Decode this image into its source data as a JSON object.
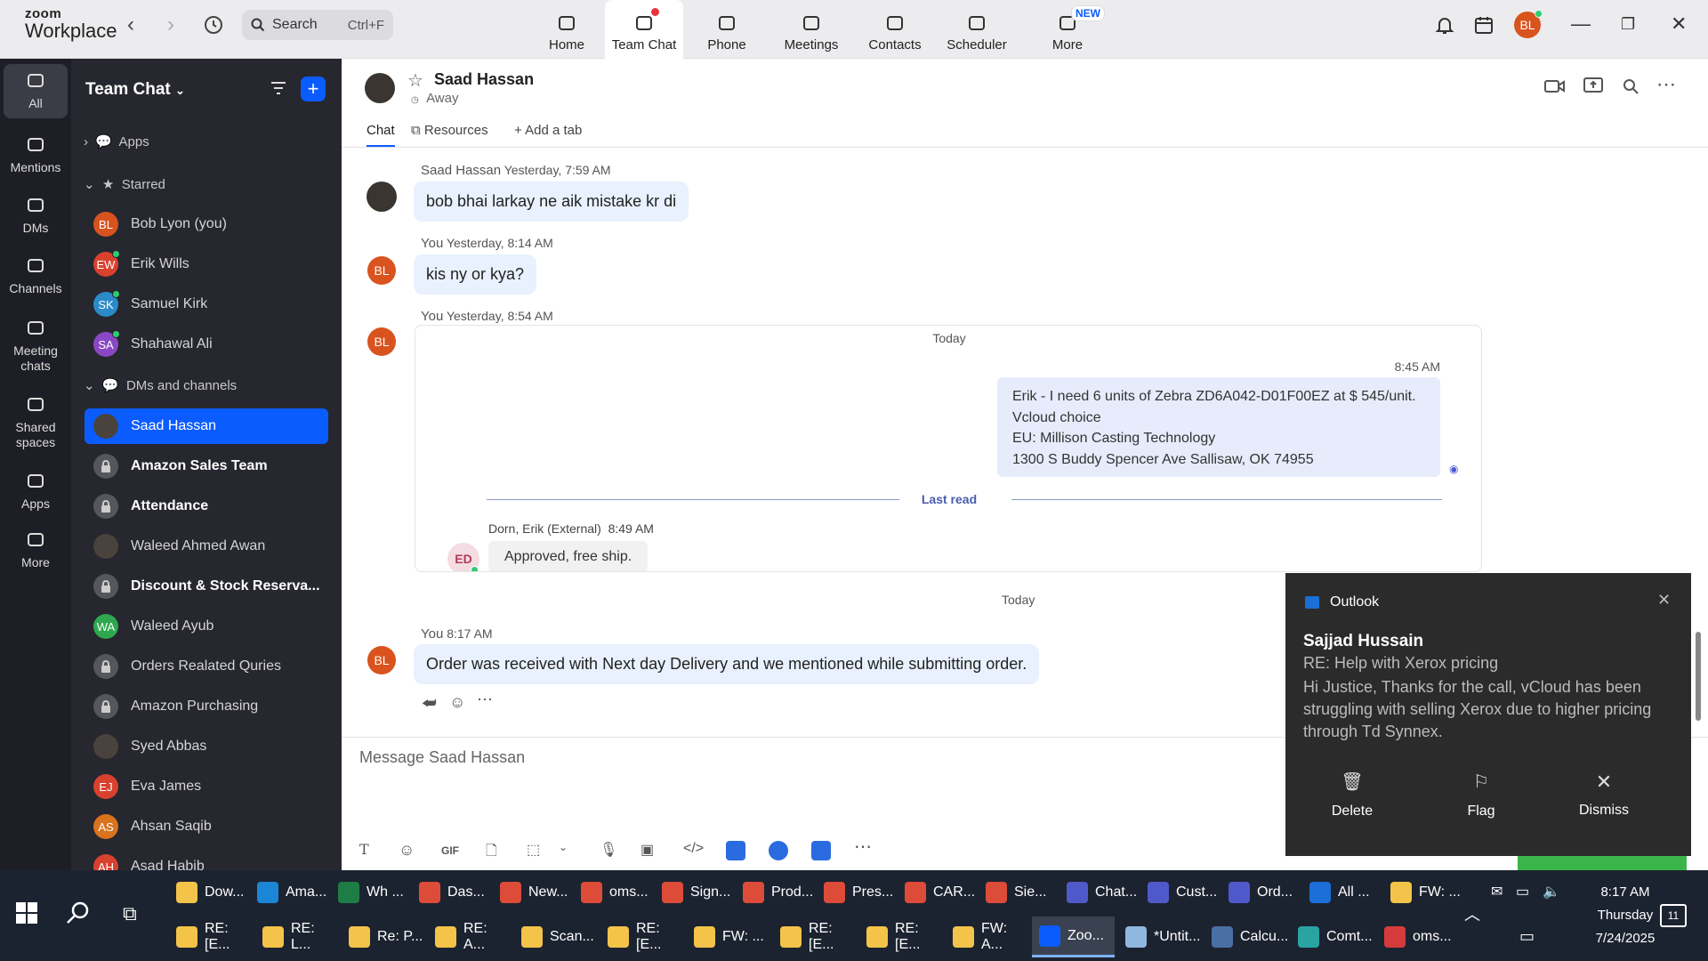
{
  "app": {
    "brand_line1": "zoom",
    "brand_line2": "Workplace"
  },
  "search": {
    "label": "Search",
    "shortcut": "Ctrl+F"
  },
  "nav": [
    {
      "label": "Home",
      "icon": "home-icon"
    },
    {
      "label": "Team Chat",
      "icon": "chat-icon",
      "active": true
    },
    {
      "label": "Phone",
      "icon": "phone-icon"
    },
    {
      "label": "Meetings",
      "icon": "video-icon"
    },
    {
      "label": "Contacts",
      "icon": "contacts-icon"
    },
    {
      "label": "Scheduler",
      "icon": "calendar-icon"
    },
    {
      "label": "More",
      "icon": "more-icon",
      "badge": "NEW"
    }
  ],
  "user_avatar": "BL",
  "rail": [
    {
      "label": "All",
      "icon": "chat-bubble-icon"
    },
    {
      "label": "Mentions",
      "icon": "at-icon"
    },
    {
      "label": "DMs",
      "icon": "people-icon"
    },
    {
      "label": "Channels",
      "icon": "hash-icon"
    },
    {
      "label": "Meeting chats",
      "icon": "calendar-icon"
    },
    {
      "label": "Shared spaces",
      "icon": "shared-icon"
    },
    {
      "label": "Apps",
      "icon": "apps-icon"
    },
    {
      "label": "More",
      "icon": "dots-icon"
    }
  ],
  "sidebar": {
    "title": "Team Chat",
    "apps_label": "Apps",
    "starred_label": "Starred",
    "starred": [
      {
        "initials": "BL",
        "name": "Bob Lyon (you)",
        "color": "#d9531e"
      },
      {
        "initials": "EW",
        "name": "Erik Wills",
        "color": "#d9412f",
        "online": true
      },
      {
        "initials": "SK",
        "name": "Samuel Kirk",
        "color": "#2a8bc9",
        "online": true
      },
      {
        "initials": "SA",
        "name": "Shahawal Ali",
        "color": "#8a47c4",
        "online": true
      }
    ],
    "dms_label": "DMs and channels",
    "dms": [
      {
        "initials": "",
        "name": "Saad Hassan",
        "type": "photo",
        "active": true
      },
      {
        "name": "Amazon Sales Team",
        "type": "lock",
        "bold": true
      },
      {
        "name": "Attendance",
        "type": "lock",
        "bold": true
      },
      {
        "initials": "",
        "name": "Waleed Ahmed Awan",
        "type": "photo"
      },
      {
        "name": "Discount & Stock Reserva...",
        "type": "lock",
        "bold": true
      },
      {
        "initials": "WA",
        "name": "Waleed Ayub",
        "color": "#2ea84f"
      },
      {
        "name": "Orders Realated Quries",
        "type": "lock"
      },
      {
        "name": "Amazon Purchasing",
        "type": "lock"
      },
      {
        "initials": "",
        "name": "Syed Abbas",
        "type": "photo"
      },
      {
        "initials": "EJ",
        "name": "Eva James",
        "color": "#d9412f"
      },
      {
        "initials": "AS",
        "name": "Ahsan Saqib",
        "color": "#d9731e"
      },
      {
        "initials": "AH",
        "name": "Asad Habib",
        "color": "#d9412f"
      }
    ]
  },
  "chat": {
    "name": "Saad Hassan",
    "status": "Away",
    "tabs": [
      "Chat",
      "Resources",
      "Add a tab"
    ],
    "messages": [
      {
        "author": "Saad Hassan",
        "time": "Yesterday, 7:59 AM",
        "text": "bob bhai larkay ne aik mistake kr di"
      },
      {
        "author": "You",
        "time": "Yesterday, 8:14 AM",
        "text": "kis ny or kya?"
      },
      {
        "author": "You",
        "time": "Yesterday, 8:54 AM"
      },
      {
        "author": "You",
        "time": "8:17 AM",
        "text": "Order was received with Next day Delivery and we mentioned while submitting order."
      }
    ],
    "card": {
      "day": "Today",
      "time": "8:45 AM",
      "lines": [
        "Erik -  I need 6 units of Zebra ZD6A042-D01F00EZ at $ 545/unit.",
        "Vcloud choice",
        "EU: Millison Casting Technology",
        "1300 S Buddy Spencer Ave Sallisaw, OK 74955"
      ],
      "last_read": "Last read",
      "reply_author": "Dorn, Erik (External)",
      "reply_time": "8:49 AM",
      "reply_initials": "ED",
      "reply_text": "Approved, free ship."
    },
    "divider_day": "Today",
    "composer_placeholder": "Message Saad Hassan"
  },
  "notification": {
    "app": "Outlook",
    "sender": "Sajjad Hussain",
    "subject": "RE: Help with Xerox pricing",
    "body": "Hi Justice, Thanks for the call, vCloud has been struggling with selling Xerox due to higher pricing through Td Synnex.",
    "actions": [
      "Delete",
      "Flag",
      "Dismiss"
    ]
  },
  "taskbar": {
    "row1": [
      {
        "label": "Dow...",
        "color": "#f3c34a"
      },
      {
        "label": "Ama...",
        "color": "#1b86d6"
      },
      {
        "label": "Wh ...",
        "color": "#1e7d45"
      },
      {
        "label": "Das...",
        "color": "#dd4b39"
      },
      {
        "label": "New...",
        "color": "#dd4b39"
      },
      {
        "label": "oms...",
        "color": "#dd4b39"
      },
      {
        "label": "Sign...",
        "color": "#dd4b39"
      },
      {
        "label": "Prod...",
        "color": "#dd4b39"
      },
      {
        "label": "Pres...",
        "color": "#dd4b39"
      },
      {
        "label": "CAR...",
        "color": "#dd4b39"
      },
      {
        "label": "Sie...",
        "color": "#dd4b39"
      },
      {
        "label": "Chat...",
        "color": "#5059c9"
      },
      {
        "label": "Cust...",
        "color": "#5059c9"
      },
      {
        "label": "Ord...",
        "color": "#5059c9"
      },
      {
        "label": "All ...",
        "color": "#1b6fd6"
      },
      {
        "label": "FW: ...",
        "color": "#f3c34a"
      }
    ],
    "row2": [
      {
        "label": "RE: [E...",
        "color": "#f3c34a"
      },
      {
        "label": "RE: L...",
        "color": "#f3c34a"
      },
      {
        "label": "Re: P...",
        "color": "#f3c34a"
      },
      {
        "label": "RE: A...",
        "color": "#f3c34a"
      },
      {
        "label": "Scan...",
        "color": "#f3c34a"
      },
      {
        "label": "RE: [E...",
        "color": "#f3c34a"
      },
      {
        "label": "FW: ...",
        "color": "#f3c34a"
      },
      {
        "label": "RE: [E...",
        "color": "#f3c34a"
      },
      {
        "label": "RE: [E...",
        "color": "#f3c34a"
      },
      {
        "label": "FW: A...",
        "color": "#f3c34a"
      },
      {
        "label": "Zoo...",
        "color": "#0b5cff",
        "active": true
      },
      {
        "label": "*Untit...",
        "color": "#8fb7e0"
      },
      {
        "label": "Calcu...",
        "color": "#4a6fa5"
      },
      {
        "label": "Comt...",
        "color": "#2aa3a3"
      },
      {
        "label": "oms...",
        "color": "#d63b3b"
      }
    ],
    "time": "8:17 AM",
    "day": "Thursday",
    "date": "7/24/2025",
    "notif_count": "11"
  }
}
